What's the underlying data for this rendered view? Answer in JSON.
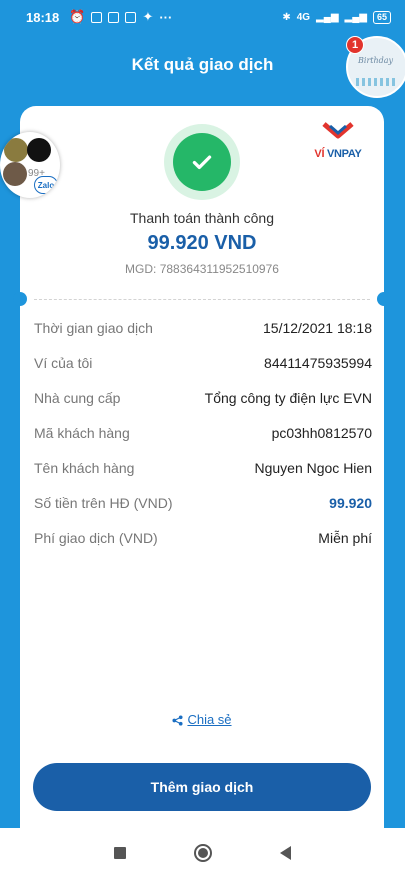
{
  "status_bar": {
    "time": "18:18",
    "battery": "65",
    "more": "···",
    "network": "4G"
  },
  "header": {
    "title": "Kết quả giao dịch",
    "notification_count": "1",
    "card_text": "Birthday"
  },
  "brand": {
    "logo_vi": "VÍ ",
    "logo_vnpay": "VNPAY"
  },
  "result": {
    "title": "Thanh toán thành công",
    "amount": "99.920 VND",
    "mgd": "MGD: 788364311952510976"
  },
  "details": [
    {
      "label": "Thời gian giao dịch",
      "value": "15/12/2021 18:18"
    },
    {
      "label": "Ví của tôi",
      "value": "84411475935994"
    },
    {
      "label": "Nhà cung cấp",
      "value": "Tổng công ty điện lực EVN"
    },
    {
      "label": "Mã khách hàng",
      "value": "pc03hh0812570"
    },
    {
      "label": "Tên khách hàng",
      "value": "Nguyen Ngoc Hien"
    },
    {
      "label": "Số tiền trên HĐ (VND)",
      "value": "99.920"
    },
    {
      "label": "Phí giao dịch (VND)",
      "value": "Miễn phí"
    }
  ],
  "share": {
    "label": "Chia sẻ"
  },
  "primary_button": {
    "label": "Thêm giao dịch"
  },
  "chat_bubble": {
    "app": "Zalo",
    "count": "99+"
  },
  "colors": {
    "brand_blue": "#1a5fa8",
    "background_blue": "#1e95dc",
    "success_green": "#25b768",
    "vnpay_red": "#e2342d"
  }
}
